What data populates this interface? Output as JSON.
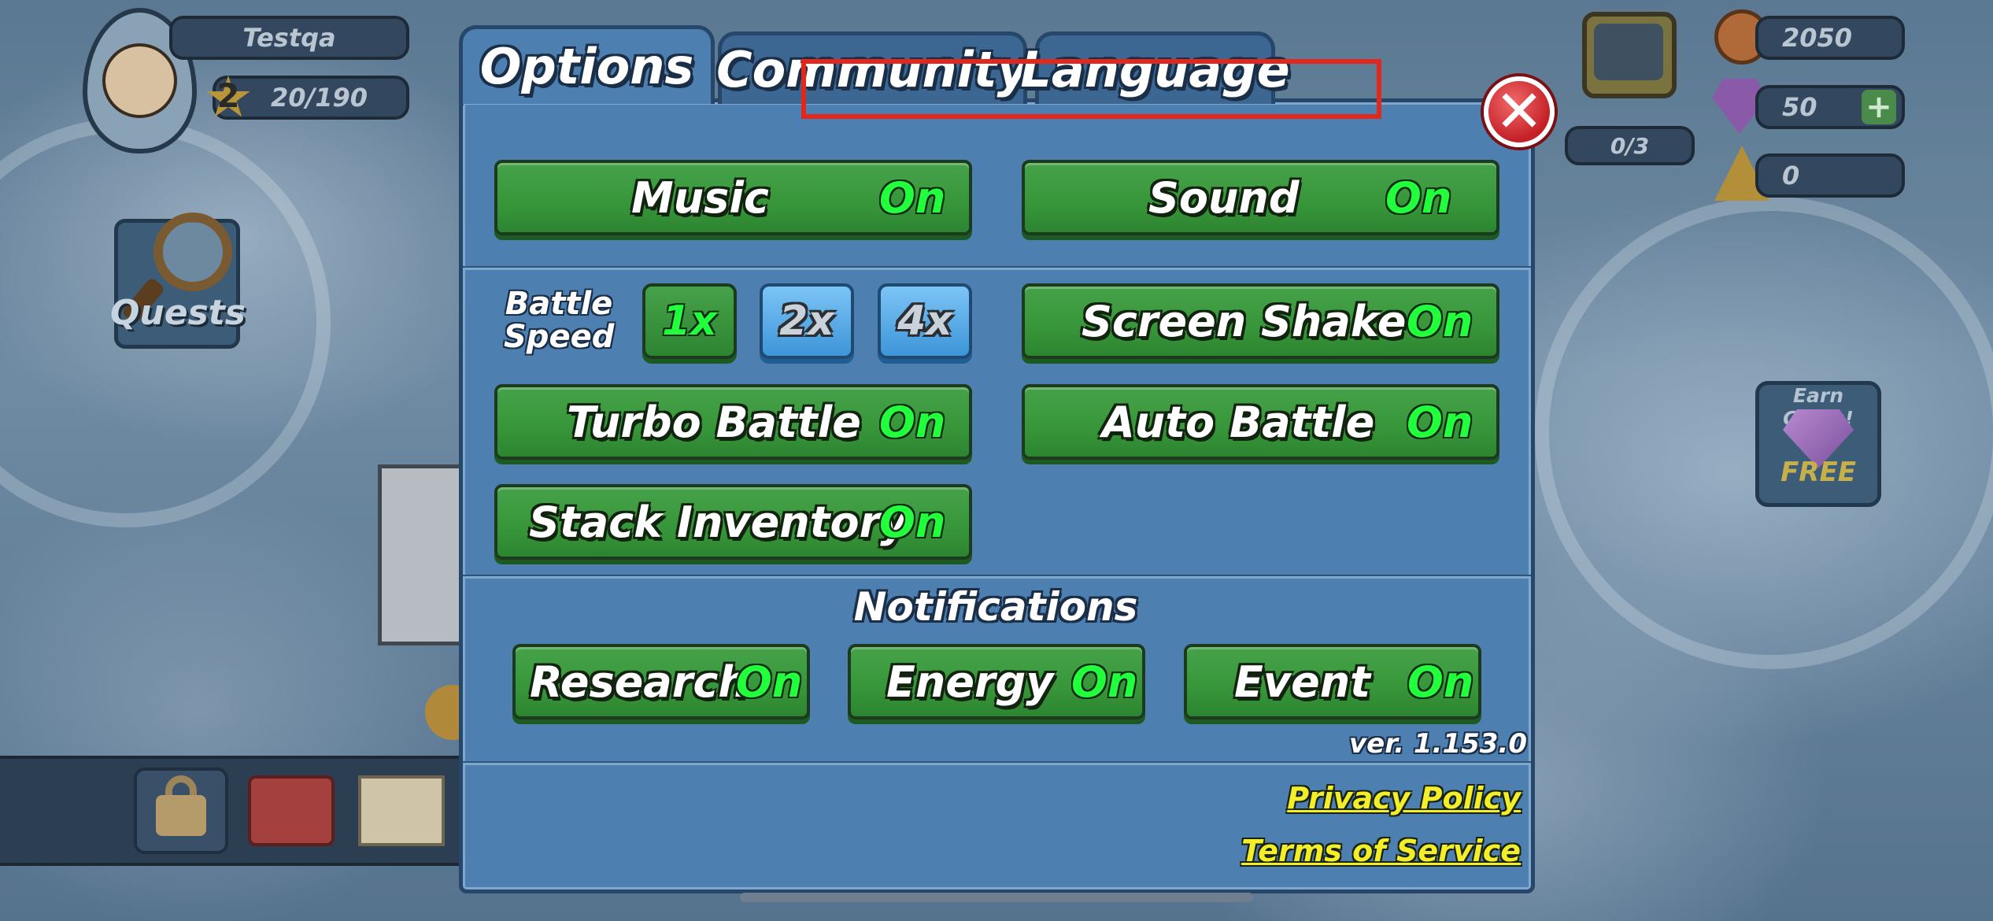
{
  "hud": {
    "player_name": "Testqa",
    "level": "2",
    "xp": "20/190",
    "quests_label": "Quests",
    "tv_counter": "0/3",
    "coins": "2050",
    "gems": "50",
    "pizza": "0",
    "earn_gems_title": "Earn Gems!",
    "earn_gems_free": "FREE"
  },
  "dialog": {
    "tabs": [
      "Options",
      "Community",
      "Language"
    ],
    "active_tab": "Options",
    "close_icon": "close-x-icon",
    "general": {
      "music": {
        "label": "Music",
        "value": "On"
      },
      "sound": {
        "label": "Sound",
        "value": "On"
      }
    },
    "battle": {
      "speed_label_line1": "Battle",
      "speed_label_line2": "Speed",
      "speeds": [
        "1x",
        "2x",
        "4x"
      ],
      "selected_speed": "1x",
      "screen_shake": {
        "label": "Screen Shake",
        "value": "On"
      },
      "turbo_battle": {
        "label": "Turbo Battle",
        "value": "On"
      },
      "auto_battle": {
        "label": "Auto Battle",
        "value": "On"
      },
      "stack_inventory": {
        "label": "Stack Inventory",
        "value": "On"
      }
    },
    "notifications": {
      "title": "Notifications",
      "research": {
        "label": "Research",
        "value": "On"
      },
      "energy": {
        "label": "Energy",
        "value": "On"
      },
      "event": {
        "label": "Event",
        "value": "On"
      }
    },
    "version": "ver. 1.153.0",
    "links": {
      "privacy": "Privacy Policy",
      "terms": "Terms of Service"
    }
  },
  "colors": {
    "toggle_on": "#22ff3c",
    "button_green": "#379639",
    "dialog_blue": "#4d7fb0",
    "highlight_red": "#e0281c",
    "link_yellow": "#f2ee2a"
  }
}
